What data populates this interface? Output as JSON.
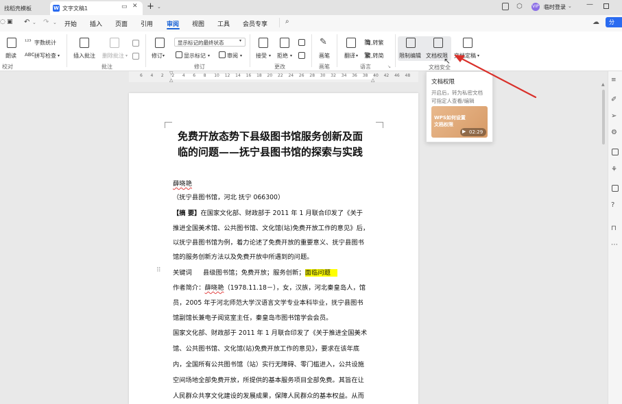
{
  "titlebar": {
    "tab1_label": "找稻壳模板",
    "tab2_label": "文字文稿1",
    "new_tab": "+",
    "login_label": "临时登录"
  },
  "menubar": {
    "items": [
      "开始",
      "插入",
      "页面",
      "引用",
      "审阅",
      "视图",
      "工具",
      "会员专享"
    ],
    "active": "审阅",
    "share_label": "分"
  },
  "ribbon": {
    "read_label": "朗读",
    "word_count_label": "字数统计",
    "spell_check_label": "拼写检查",
    "insert_comment_label": "插入批注",
    "delete_comment_label": "删除批注",
    "revise_label": "修订",
    "show_mode_value": "显示标记的最终状态",
    "show_marks_label": "显示标记",
    "review_label": "审阅",
    "accept_label": "接受",
    "reject_label": "拒绝",
    "ink_label": "画笔",
    "translate_label": "翻译",
    "trad_label": "简,转繁",
    "simp_label": "繁,转简",
    "restrict_edit_label": "限制编辑",
    "doc_permission_label": "文档权限",
    "doc_finalize_label": "文档定稿",
    "groups": {
      "proof": "校对",
      "comment": "批注",
      "revise": "修订",
      "change": "更改",
      "ink": "画笔",
      "language": "语言",
      "security": "文档安全"
    }
  },
  "tooltip": {
    "title": "文档权限",
    "desc_line1": "开启后，转为私密文档",
    "desc_line2": "可指定人查看/编辑",
    "video_title_line1": "WPS如何设置",
    "video_title_line2": "文档权限",
    "video_duration": "02:29"
  },
  "ruler": {
    "ticks": [
      "6",
      "4",
      "2",
      "2",
      "4",
      "6",
      "8",
      "10",
      "12",
      "14",
      "16",
      "18",
      "20",
      "22",
      "24",
      "26",
      "28",
      "30",
      "32",
      "34",
      "36",
      "38",
      "40",
      "42",
      "46",
      "48"
    ]
  },
  "document": {
    "title_line1": "免费开放态势下县级图书馆服务创新及面",
    "title_line2": "临的问题——抚宁县图书馆的探索与实践",
    "author": "薛晓艳",
    "affiliation": "（抚宁县图书馆，河北  抚宁  066300）",
    "abstract_label": "【摘    要】",
    "abstract_line1": "在国家文化部、财政部于 2011 年 1 月联合印发了《关于",
    "abstract_line2": "推进全国美术馆、公共图书馆、文化馆(站)免费开放工作的意见》后，",
    "abstract_line3": "以抚宁县图书馆为例，着力论述了免费开放的重要意义、抚宁县图书",
    "abstract_line4": "馆的服务创新方法以及免费开放中所遇到的问题。",
    "keywords_label": "关键词",
    "keywords_text": "县级图书馆；免费开放；服务创新；",
    "keywords_highlight": "面临问题",
    "bio_line1_a": "作者简介：",
    "bio_line1_name": "薛晓艳",
    "bio_line1_b": "（1978.11.18－），女，汉族，河北秦皇岛人，馆",
    "bio_line2": "员，2005 年于河北师范大学汉语言文学专业本科毕业，抚宁县图书",
    "bio_line3": "馆副馆长兼电子阅览室主任，秦皇岛市图书馆学会会员。",
    "body_line1": "国家文化部、财政部于 2011 年 1 月联合印发了《关于推进全国美术",
    "body_line2": "馆、公共图书馆、文化馆(站)免费开放工作的意见》，要求在该年底",
    "body_line3": "内，全国所有公共图书馆（站）实行无障碍、零门槛进入，公共设施",
    "body_line4": "空间场地全部免费开放，所提供的基本服务项目全部免费。其旨在让",
    "body_line5": "人民群众共享文化建设的发展成果，保障人民群众的基本权益。从而"
  },
  "colors": {
    "accent": "#1a63d6",
    "arrow": "#d9302a",
    "highlight": "#ffff00"
  }
}
